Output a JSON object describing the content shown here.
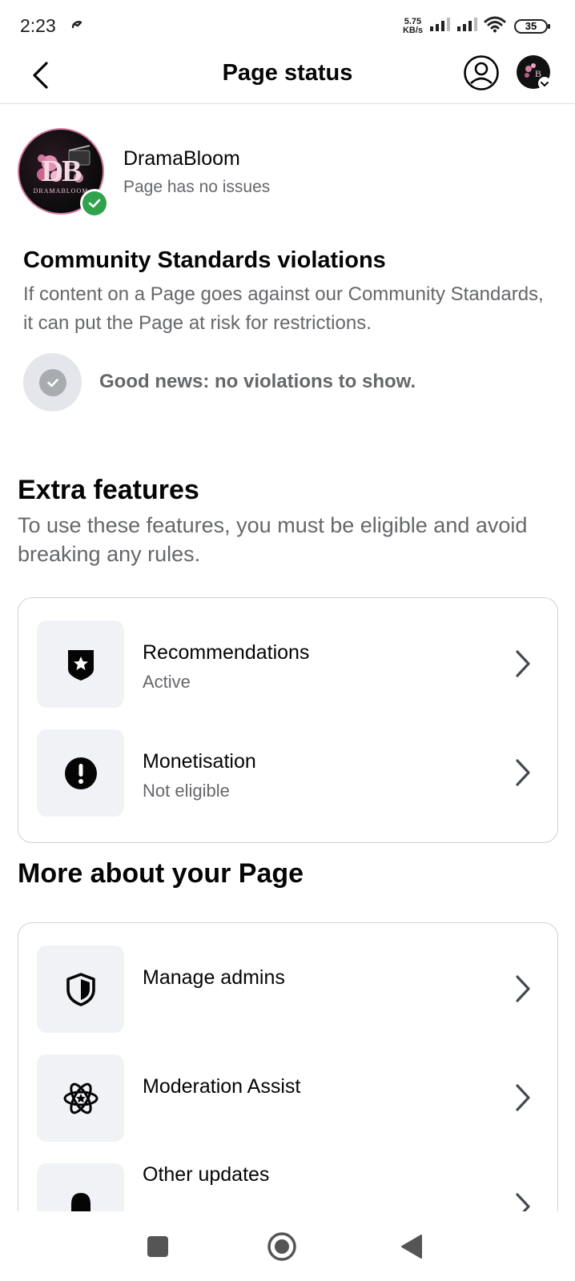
{
  "status_bar": {
    "time": "2:23",
    "speed_value": "5.75",
    "speed_unit": "KB/s",
    "battery": "35"
  },
  "header": {
    "title": "Page status"
  },
  "page": {
    "name": "DramaBloom",
    "status": "Page has no issues",
    "avatar_text": "DB",
    "avatar_caption": "DRAMABLOOM"
  },
  "community_standards": {
    "title": "Community Standards violations",
    "description": "If content on a Page goes against our Community Standards, it can put the Page at risk for restrictions.",
    "empty_message": "Good news: no violations to show."
  },
  "extra_features": {
    "title": "Extra features",
    "description": "To use these features, you must be eligible and avoid breaking any rules.",
    "items": [
      {
        "label": "Recommendations",
        "status": "Active",
        "icon": "badge-star-icon"
      },
      {
        "label": "Monetisation",
        "status": "Not eligible",
        "icon": "alert-icon"
      }
    ]
  },
  "more_about": {
    "title": "More about your Page",
    "items": [
      {
        "label": "Manage admins",
        "icon": "shield-icon"
      },
      {
        "label": "Moderation Assist",
        "icon": "atom-icon"
      },
      {
        "label": "Other updates",
        "icon": "bell-icon"
      }
    ]
  },
  "colors": {
    "success": "#31a24c",
    "secondary_text": "#65676b",
    "icon_background": "#f0f2f5",
    "border": "#ced0d4"
  }
}
